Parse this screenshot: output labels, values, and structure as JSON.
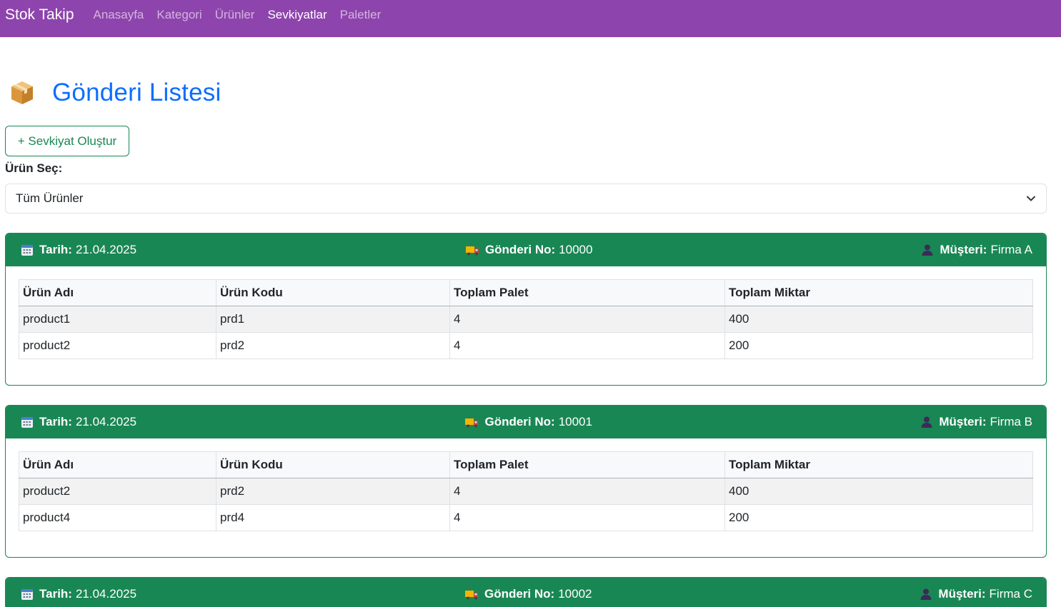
{
  "navbar": {
    "brand": "Stok Takip",
    "items": [
      {
        "label": "Anasayfa",
        "active": false
      },
      {
        "label": "Kategori",
        "active": false
      },
      {
        "label": "Ürünler",
        "active": false
      },
      {
        "label": "Sevkiyatlar",
        "active": true
      },
      {
        "label": "Paletler",
        "active": false
      }
    ],
    "color": "#8e44ad"
  },
  "page": {
    "title_icon": "package-box-icon",
    "title": "Gönderi Listesi",
    "create_button": "+ Sevkiyat Oluştur",
    "filter_label": "Ürün Seç:",
    "filter_value": "Tüm Ürünler"
  },
  "labels": {
    "date": "Tarih:",
    "shipment_no": "Gönderi No:",
    "customer": "Müşteri:",
    "columns": [
      "Ürün Adı",
      "Ürün Kodu",
      "Toplam Palet",
      "Toplam Miktar"
    ]
  },
  "shipments": [
    {
      "date": "21.04.2025",
      "no": "10000",
      "customer": "Firma A",
      "rows": [
        [
          "product1",
          "prd1",
          "4",
          "400"
        ],
        [
          "product2",
          "prd2",
          "4",
          "200"
        ]
      ]
    },
    {
      "date": "21.04.2025",
      "no": "10001",
      "customer": "Firma B",
      "rows": [
        [
          "product2",
          "prd2",
          "4",
          "400"
        ],
        [
          "product4",
          "prd4",
          "4",
          "200"
        ]
      ]
    },
    {
      "date": "21.04.2025",
      "no": "10002",
      "customer": "Firma C",
      "rows": []
    }
  ],
  "colors": {
    "accent": "#0d6efd",
    "success": "#198754"
  }
}
